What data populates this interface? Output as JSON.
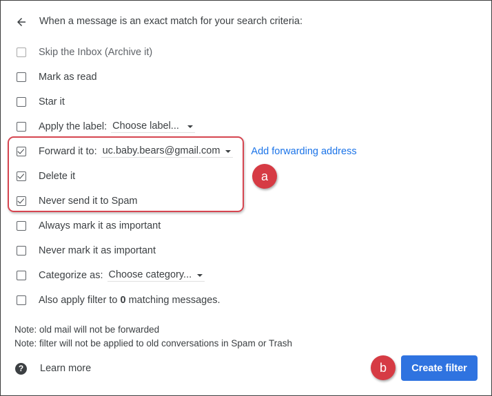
{
  "header": {
    "back_icon": "arrow-left-icon",
    "title": "When a message is an exact match for your search criteria:"
  },
  "options": [
    {
      "label": "Skip the Inbox (Archive it)",
      "checked": false,
      "disabled": true
    },
    {
      "label": "Mark as read",
      "checked": false
    },
    {
      "label": "Star it",
      "checked": false
    },
    {
      "label": "Apply the label:",
      "checked": false,
      "dropdown": "Choose label..."
    },
    {
      "label": "Forward it to:",
      "checked": true,
      "dropdown": "uc.baby.bears@gmail.com",
      "link": "Add forwarding address"
    },
    {
      "label": "Delete it",
      "checked": true
    },
    {
      "label": "Never send it to Spam",
      "checked": true
    },
    {
      "label": "Always mark it as important",
      "checked": false
    },
    {
      "label": "Never mark it as important",
      "checked": false
    },
    {
      "label": "Categorize as:",
      "checked": false,
      "dropdown": "Choose category..."
    },
    {
      "label_prefix": "Also apply filter to",
      "count": "0",
      "label_suffix": "matching messages.",
      "checked": false
    }
  ],
  "notes": [
    "Note: old mail will not be forwarded",
    "Note: filter will not be applied to old conversations in Spam or Trash"
  ],
  "footer": {
    "help_icon": "help-circle-icon",
    "learn_more": "Learn more",
    "create_filter": "Create filter"
  },
  "annotations": {
    "badge_a": "a",
    "badge_b": "b",
    "highlight_color": "#d64550",
    "badge_color": "#d63b44"
  },
  "colors": {
    "button": "#2f73e0",
    "link": "#1a73e8"
  }
}
